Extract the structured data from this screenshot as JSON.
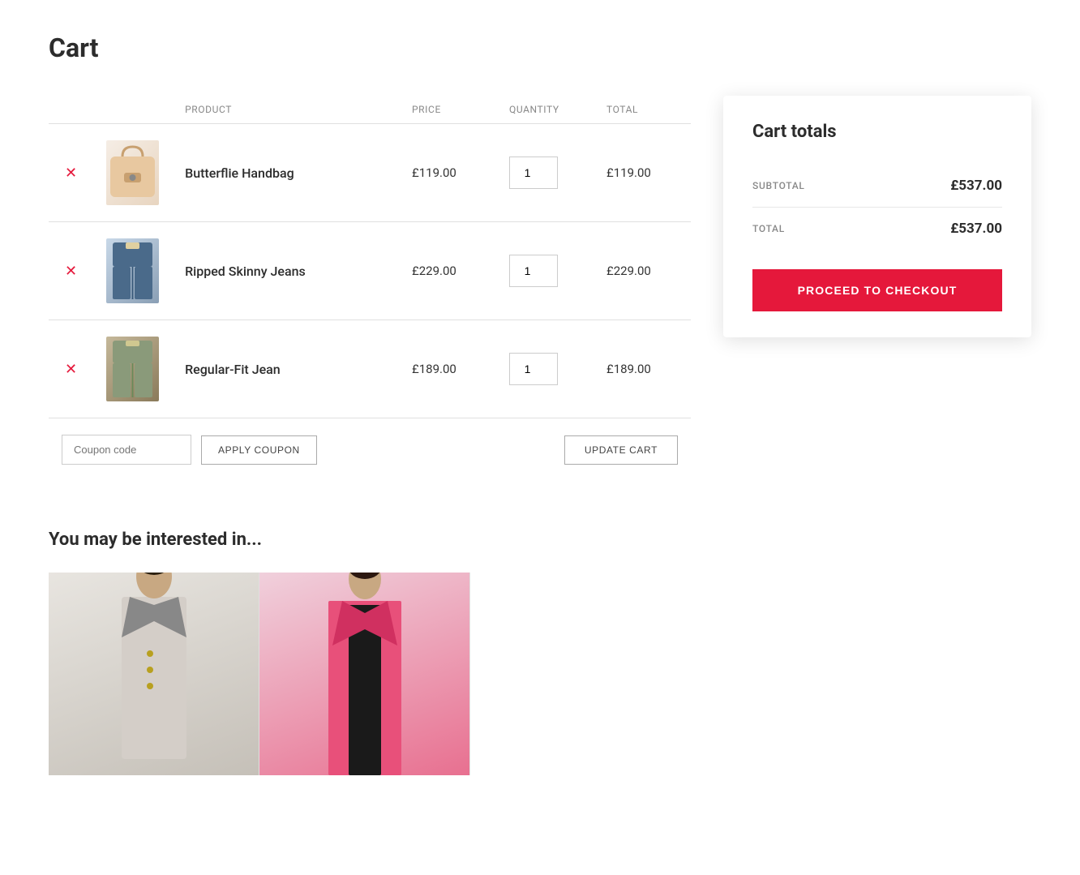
{
  "page": {
    "title": "Cart"
  },
  "table": {
    "headers": {
      "product": "PRODUCT",
      "price": "PRICE",
      "quantity": "QUANTITY",
      "total": "TOTAL"
    },
    "items": [
      {
        "id": 1,
        "name": "Butterflie Handbag",
        "price": "£119.00",
        "quantity": 1,
        "total": "£119.00",
        "image_class": "img-handbag"
      },
      {
        "id": 2,
        "name": "Ripped Skinny Jeans",
        "price": "£229.00",
        "quantity": 1,
        "total": "£229.00",
        "image_class": "img-jeans"
      },
      {
        "id": 3,
        "name": "Regular-Fit Jean",
        "price": "£189.00",
        "quantity": 1,
        "total": "£189.00",
        "image_class": "img-jean2"
      }
    ]
  },
  "coupon": {
    "placeholder": "Coupon code",
    "apply_label": "APPLY COUPON"
  },
  "update_cart_label": "UPDATE CART",
  "cart_totals": {
    "title": "Cart totals",
    "subtotal_label": "SUBTOTAL",
    "subtotal_value": "£537.00",
    "total_label": "TOTAL",
    "total_value": "£537.00",
    "checkout_label": "PROCEED TO CHECKOUT"
  },
  "recommended": {
    "title": "You may be interested in...",
    "items": [
      {
        "id": 1,
        "image_class": "img-blazer"
      },
      {
        "id": 2,
        "image_class": "img-pink-blazer"
      }
    ]
  }
}
